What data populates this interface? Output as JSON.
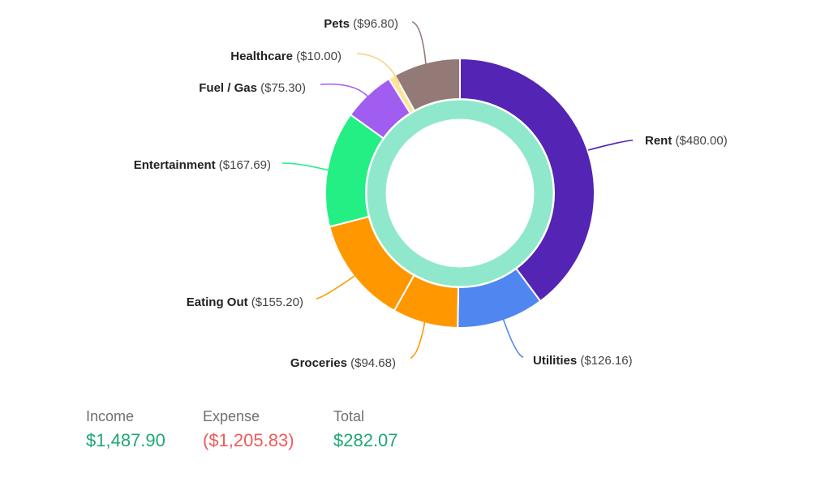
{
  "chart_data": {
    "type": "pie",
    "variant": "donut",
    "categories": [
      "Rent",
      "Utilities",
      "Groceries",
      "Eating Out",
      "Entertainment",
      "Fuel / Gas",
      "Healthcare",
      "Pets"
    ],
    "values": [
      480.0,
      126.16,
      94.68,
      155.2,
      167.69,
      75.3,
      10.0,
      96.8
    ],
    "value_labels": [
      "($480.00)",
      "($126.16)",
      "($94.68)",
      "($155.20)",
      "($167.69)",
      "($75.30)",
      "($10.00)",
      "($96.80)"
    ],
    "colors": [
      "#5424b4",
      "#4f86f0",
      "#ff9800",
      "#ff9800",
      "#23ef84",
      "#a15cf0",
      "#ffe39b",
      "#937a77"
    ],
    "inner_ring_color": "#8fe8cb",
    "title": "",
    "legend": "none"
  },
  "summary": {
    "income_label": "Income",
    "income_value": "$1,487.90",
    "expense_label": "Expense",
    "expense_value": "($1,205.83)",
    "total_label": "Total",
    "total_value": "$282.07",
    "colors": {
      "positive": "#1fa774",
      "negative": "#f05a5a",
      "label": "#6f6f6f"
    }
  }
}
